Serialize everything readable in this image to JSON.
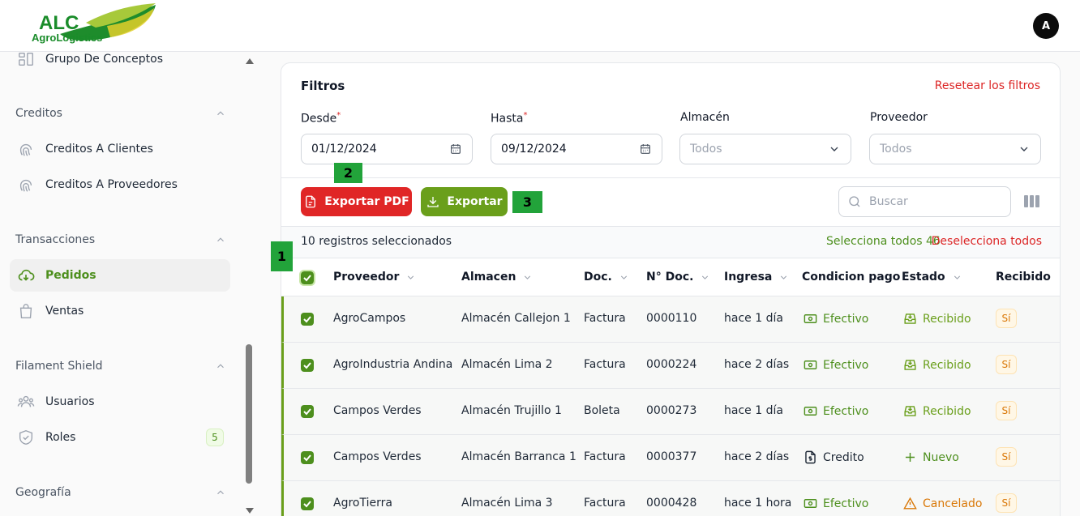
{
  "app": {
    "logo_text_top": "ALC",
    "logo_text_bottom": "AgroLogistics",
    "avatar_initial": "A"
  },
  "sidebar": {
    "items_top": [
      {
        "label": "Grupo De Conceptos",
        "icon": "layout-icon"
      }
    ],
    "groups": [
      {
        "title": "Creditos",
        "items": [
          {
            "label": "Creditos A Clientes",
            "icon": "fingerprint-icon"
          },
          {
            "label": "Creditos A Proveedores",
            "icon": "fingerprint-icon"
          }
        ]
      },
      {
        "title": "Transacciones",
        "items": [
          {
            "label": "Pedidos",
            "icon": "cloud-download-icon",
            "active": true
          },
          {
            "label": "Ventas",
            "icon": "shopping-bag-icon"
          }
        ]
      },
      {
        "title": "Filament Shield",
        "items": [
          {
            "label": "Usuarios",
            "icon": "users-icon"
          },
          {
            "label": "Roles",
            "icon": "shield-icon",
            "badge": "5"
          }
        ]
      },
      {
        "title": "Geografía",
        "items": []
      }
    ]
  },
  "filters": {
    "title": "Filtros",
    "reset_label": "Resetear los filtros",
    "desde_label": "Desde",
    "desde_value": "01/12/2024",
    "hasta_label": "Hasta",
    "hasta_value": "09/12/2024",
    "almacen_label": "Almacén",
    "almacen_value": "Todos",
    "proveedor_label": "Proveedor",
    "proveedor_value": "Todos"
  },
  "toolbar": {
    "export_pdf_label": "Exportar PDF",
    "export_label": "Exportar",
    "search_placeholder": "Buscar"
  },
  "selection": {
    "count_text": "10 registros seleccionados",
    "select_all_text": "Selecciona todos 46",
    "deselect_all_text": "Deselecciona todos"
  },
  "table": {
    "headers": [
      "Proveedor",
      "Almacen",
      "Doc.",
      "N° Doc.",
      "Ingresa",
      "Condicion pago",
      "Estado",
      "Recibido"
    ],
    "rows": [
      {
        "proveedor": "AgroCampos",
        "almacen": "Almacén Callejon 1",
        "doc": "Factura",
        "ndoc": "0000110",
        "ingresa": "hace 1 día",
        "condicion": "Efectivo",
        "estado": "Recibido",
        "recibido": "Sí"
      },
      {
        "proveedor": "AgroIndustria Andina",
        "almacen": "Almacén Lima 2",
        "doc": "Factura",
        "ndoc": "0000224",
        "ingresa": "hace 2 días",
        "condicion": "Efectivo",
        "estado": "Recibido",
        "recibido": "Sí"
      },
      {
        "proveedor": "Campos Verdes",
        "almacen": "Almacén Trujillo 1",
        "doc": "Boleta",
        "ndoc": "0000273",
        "ingresa": "hace 1 día",
        "condicion": "Efectivo",
        "estado": "Recibido",
        "recibido": "Sí"
      },
      {
        "proveedor": "Campos Verdes",
        "almacen": "Almacén Barranca 1",
        "doc": "Factura",
        "ndoc": "0000377",
        "ingresa": "hace 2 días",
        "condicion": "Credito",
        "estado": "Nuevo",
        "recibido": "Sí"
      },
      {
        "proveedor": "AgroTierra",
        "almacen": "Almacén Lima 3",
        "doc": "Factura",
        "ndoc": "0000428",
        "ingresa": "hace 1 hora",
        "condicion": "Efectivo",
        "estado": "Cancelado",
        "recibido": "Sí"
      }
    ]
  },
  "markers": [
    "1",
    "2",
    "3"
  ],
  "colors": {
    "brand_green": "#6a9f1b",
    "danger_red": "#e02626",
    "warning_orange": "#d97706"
  }
}
